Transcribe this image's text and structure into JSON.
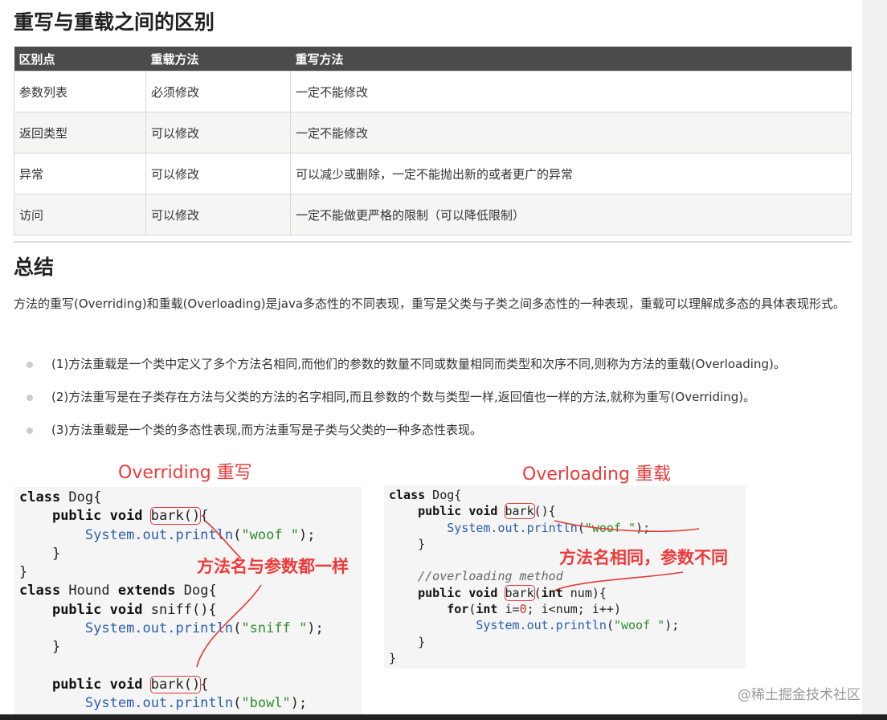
{
  "section1": {
    "title": "重写与重载之间的区别"
  },
  "table": {
    "headers": [
      "区别点",
      "重载方法",
      "重写方法"
    ],
    "rows": [
      [
        "参数列表",
        "必须修改",
        "一定不能修改"
      ],
      [
        "返回类型",
        "可以修改",
        "一定不能修改"
      ],
      [
        "异常",
        "可以修改",
        "可以减少或删除，一定不能抛出新的或者更广的异常"
      ],
      [
        "访问",
        "可以修改",
        "一定不能做更严格的限制（可以降低限制）"
      ]
    ]
  },
  "section2": {
    "title": "总结",
    "paragraph": "方法的重写(Overriding)和重载(Overloading)是java多态性的不同表现，重写是父类与子类之间多态性的一种表现，重载可以理解成多态的具体表现形式。",
    "points": [
      "(1)方法重载是一个类中定义了多个方法名相同,而他们的参数的数量不同或数量相同而类型和次序不同,则称为方法的重载(Overloading)。",
      "(2)方法重写是在子类存在方法与父类的方法的名字相同,而且参数的个数与类型一样,返回值也一样的方法,就称为重写(Overriding)。",
      "(3)方法重载是一个类的多态性表现,而方法重写是子类与父类的一种多态性表现。"
    ]
  },
  "figure": {
    "left_label": "Overriding  重写",
    "left_annotation": "方法名与参数都一样",
    "right_label": "Overloading  重载",
    "right_annotation": "方法名相同，参数不同"
  },
  "watermark": "@稀土掘金技术社区"
}
